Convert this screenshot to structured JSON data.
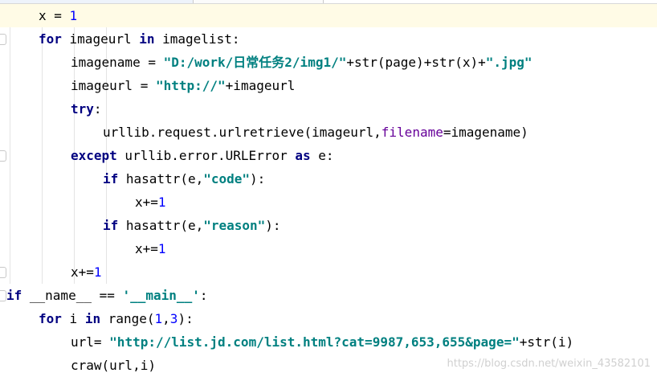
{
  "editor": {
    "lines": [
      {
        "indent": 1,
        "tokens": [
          [
            "x = ",
            ""
          ],
          [
            "1",
            "num"
          ]
        ]
      },
      {
        "indent": 1,
        "tokens": [
          [
            "for",
            "kw"
          ],
          [
            " imageurl ",
            ""
          ],
          [
            "in",
            "kw"
          ],
          [
            " imagelist:",
            ""
          ]
        ]
      },
      {
        "indent": 2,
        "tokens": [
          [
            "imagename = ",
            ""
          ],
          [
            "\"D:/work/日常任务2/img1/\"",
            "str"
          ],
          [
            "+str(page)+str(x)+",
            ""
          ],
          [
            "\".jpg\"",
            "str"
          ]
        ]
      },
      {
        "indent": 2,
        "tokens": [
          [
            "imageurl = ",
            ""
          ],
          [
            "\"http://\"",
            "str"
          ],
          [
            "+imageurl",
            ""
          ]
        ]
      },
      {
        "indent": 2,
        "tokens": [
          [
            "try",
            "kw"
          ],
          [
            ":",
            ""
          ]
        ]
      },
      {
        "indent": 3,
        "tokens": [
          [
            "urllib.request.urlretrieve(imageurl,",
            ""
          ],
          [
            "filename",
            "param"
          ],
          [
            "=imagename)",
            ""
          ]
        ]
      },
      {
        "indent": 2,
        "tokens": [
          [
            "except",
            "kw"
          ],
          [
            " urllib.error.URLError ",
            ""
          ],
          [
            "as",
            "kw"
          ],
          [
            " e:",
            ""
          ]
        ]
      },
      {
        "indent": 3,
        "tokens": [
          [
            "if",
            "kw"
          ],
          [
            " hasattr(e,",
            ""
          ],
          [
            "\"code\"",
            "str"
          ],
          [
            "):",
            ""
          ]
        ]
      },
      {
        "indent": 4,
        "tokens": [
          [
            "x+=",
            ""
          ],
          [
            "1",
            "num"
          ]
        ]
      },
      {
        "indent": 3,
        "tokens": [
          [
            "if",
            "kw"
          ],
          [
            " hasattr(e,",
            ""
          ],
          [
            "\"reason\"",
            "str"
          ],
          [
            "):",
            ""
          ]
        ]
      },
      {
        "indent": 4,
        "tokens": [
          [
            "x+=",
            ""
          ],
          [
            "1",
            "num"
          ]
        ]
      },
      {
        "indent": 2,
        "tokens": [
          [
            "x+=",
            ""
          ],
          [
            "1",
            "num"
          ]
        ]
      },
      {
        "indent": 0,
        "tokens": [
          [
            "if",
            "kw"
          ],
          [
            " __name__ == ",
            ""
          ],
          [
            "'__main__'",
            "str"
          ],
          [
            ":",
            ""
          ]
        ]
      },
      {
        "indent": 1,
        "tokens": [
          [
            "for",
            "kw"
          ],
          [
            " i ",
            ""
          ],
          [
            "in",
            "kw"
          ],
          [
            " range(",
            ""
          ],
          [
            "1",
            "num"
          ],
          [
            ",",
            ""
          ],
          [
            "3",
            "num"
          ],
          [
            "):",
            ""
          ]
        ]
      },
      {
        "indent": 2,
        "tokens": [
          [
            "url= ",
            ""
          ],
          [
            "\"http://list.jd.com/list.html?cat=9987,653,655&page=\"",
            "str"
          ],
          [
            "+str(i)",
            ""
          ]
        ]
      },
      {
        "indent": 2,
        "tokens": [
          [
            "craw(url,i)",
            ""
          ]
        ]
      }
    ]
  },
  "watermark": "https://blog.csdn.net/weixin_43582101",
  "colors": {
    "keyword": "#000080",
    "number": "#0000ff",
    "string": "#008080",
    "param": "#660099",
    "current_line": "#fffbe6"
  }
}
